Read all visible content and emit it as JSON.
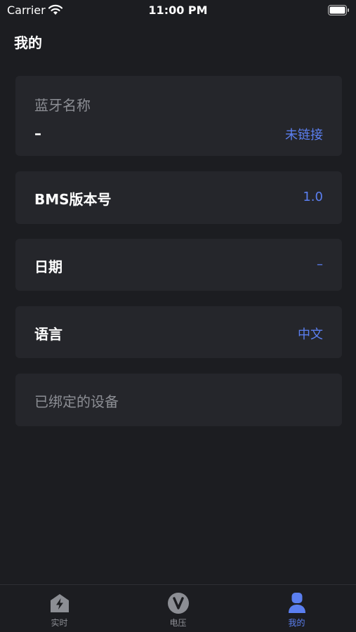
{
  "status_bar": {
    "carrier": "Carrier",
    "time": "11:00 PM"
  },
  "page": {
    "title": "我的"
  },
  "bluetooth": {
    "label": "蓝牙名称",
    "name": "–",
    "status": "未链接"
  },
  "bms": {
    "label": "BMS版本号",
    "value": "1.0"
  },
  "date": {
    "label": "日期",
    "value": "–"
  },
  "language": {
    "label": "语言",
    "value": "中文"
  },
  "devices": {
    "label": "已绑定的设备"
  },
  "tabs": [
    {
      "label": "实时",
      "icon": "bolt-house-icon"
    },
    {
      "label": "电压",
      "icon": "voltage-v-icon"
    },
    {
      "label": "我的",
      "icon": "person-icon",
      "active": true
    }
  ],
  "colors": {
    "background": "#1c1d21",
    "card": "#25262b",
    "accent": "#5b7ff0",
    "muted_text": "#8c8e94"
  }
}
